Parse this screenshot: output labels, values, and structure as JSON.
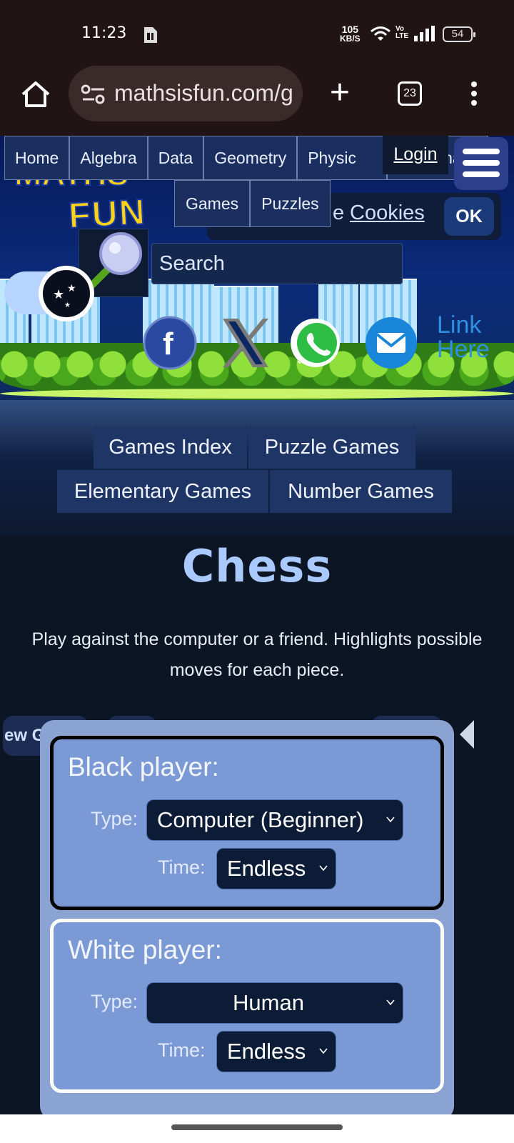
{
  "status_bar": {
    "time": "11:23",
    "net_speed_value": "105",
    "net_speed_unit": "KB/S",
    "volte_top": "Vo",
    "volte_bottom": "LTE",
    "battery": "54"
  },
  "browser": {
    "url": "mathsisfun.com/g",
    "tab_count": "23",
    "icons": [
      "home-icon",
      "site-settings-icon",
      "new-tab-icon",
      "tab-switcher-icon",
      "more-options-icon"
    ]
  },
  "site_nav": {
    "items": [
      "Home",
      "Algebra",
      "Data",
      "Geometry",
      "Physic"
    ],
    "partial_item": "ionary",
    "sub_items": [
      "Games",
      "Puzzles"
    ],
    "login": "Login"
  },
  "logo": {
    "math": "MATHS",
    "fun": "FUN"
  },
  "cookie": {
    "prefix": "e",
    "link": "Cookies",
    "ok": "OK"
  },
  "search": {
    "placeholder": "Search"
  },
  "share": {
    "link_here": "Link Here",
    "icons": [
      "facebook-icon",
      "x-icon",
      "whatsapp-icon",
      "email-icon"
    ]
  },
  "games_nav": {
    "games_index": "Games Index",
    "puzzle_games": "Puzzle Games",
    "elementary_games": "Elementary Games",
    "number_games": "Number Games"
  },
  "page": {
    "title": "Chess",
    "description_line1": "Play against the computer or a friend. Highlights possible",
    "description_line2": "moves for each piece."
  },
  "game": {
    "partial_button": "ew G",
    "black": {
      "title": "Black player:",
      "type_label": "Type:",
      "type_value": "Computer (Beginner)",
      "time_label": "Time:",
      "time_value": "Endless"
    },
    "white": {
      "title": "White player:",
      "type_label": "Type:",
      "type_value": "Human",
      "time_label": "Time:",
      "time_value": "Endless"
    }
  },
  "colors": {
    "accent": "#a9c9ff",
    "panel": "#8aa3d2",
    "player_box": "#7b99d4"
  }
}
